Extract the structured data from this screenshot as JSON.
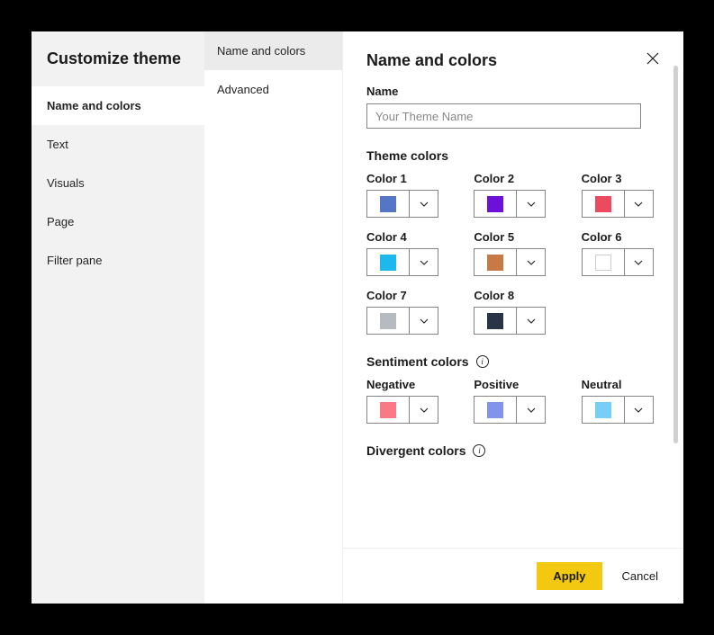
{
  "dialog": {
    "title": "Customize theme",
    "sidebar": [
      {
        "key": "name-colors",
        "label": "Name and colors",
        "active": true
      },
      {
        "key": "text",
        "label": "Text",
        "active": false
      },
      {
        "key": "visuals",
        "label": "Visuals",
        "active": false
      },
      {
        "key": "page",
        "label": "Page",
        "active": false
      },
      {
        "key": "filter-pane",
        "label": "Filter pane",
        "active": false
      }
    ],
    "subnav": [
      {
        "key": "name-colors",
        "label": "Name and colors",
        "active": true
      },
      {
        "key": "advanced",
        "label": "Advanced",
        "active": false
      }
    ]
  },
  "panel": {
    "title": "Name and colors",
    "name": {
      "label": "Name",
      "value": "",
      "placeholder": "Your Theme Name"
    },
    "themeColors": {
      "title": "Theme colors",
      "items": [
        {
          "label": "Color 1",
          "hex": "#5576C7"
        },
        {
          "label": "Color 2",
          "hex": "#6D10D9"
        },
        {
          "label": "Color 3",
          "hex": "#EC4A5E"
        },
        {
          "label": "Color 4",
          "hex": "#1FB8EC"
        },
        {
          "label": "Color 5",
          "hex": "#C77A44"
        },
        {
          "label": "Color 6",
          "hex": "#FFFFFF"
        },
        {
          "label": "Color 7",
          "hex": "#B6BBC1"
        },
        {
          "label": "Color 8",
          "hex": "#2A3447"
        }
      ]
    },
    "sentimentColors": {
      "title": "Sentiment colors",
      "items": [
        {
          "label": "Negative",
          "hex": "#F97A85"
        },
        {
          "label": "Positive",
          "hex": "#8293EC"
        },
        {
          "label": "Neutral",
          "hex": "#77CEF9"
        }
      ]
    },
    "divergentColors": {
      "title": "Divergent colors"
    }
  },
  "footer": {
    "apply": "Apply",
    "cancel": "Cancel"
  }
}
